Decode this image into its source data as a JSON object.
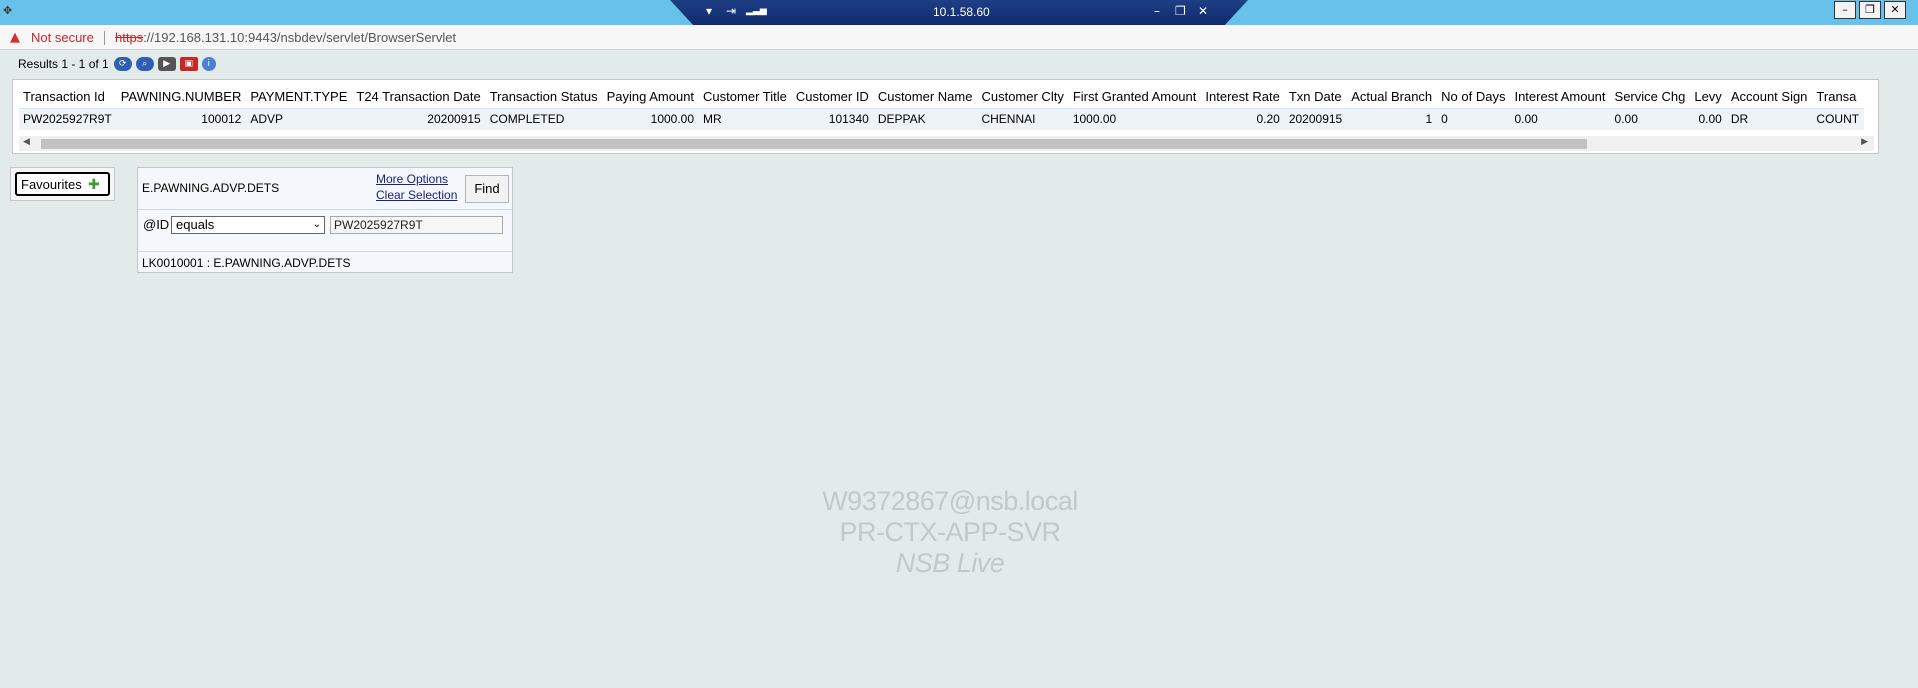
{
  "citrix": {
    "host": "10.1.58.60",
    "menu_glyph": "▾",
    "pin_glyph": "⇥",
    "signal_glyph": "▂▃▅",
    "minimize_glyph": "–",
    "restore_glyph": "❐",
    "close_glyph": "✕"
  },
  "window_controls": [
    "–",
    "❐",
    "✕"
  ],
  "address_bar": {
    "security_text": "Not secure",
    "url_scheme": "https",
    "url_rest": "://192.168.131.10:9443/nsbdev/servlet/BrowserServlet"
  },
  "toolbar": {
    "results_text": "Results 1 - 1 of 1"
  },
  "grid": {
    "columns": [
      "Transaction Id",
      "PAWNING.NUMBER",
      "PAYMENT.TYPE",
      "T24 Transaction Date",
      "Transaction Status",
      "Paying Amount",
      "Customer Title",
      "Customer ID",
      "Customer Name",
      "Customer Clty",
      "First Granted Amount",
      "Interest Rate",
      "Txn Date",
      "Actual Branch",
      "No of Days",
      "Interest Amount",
      "Service Chg",
      "Levy",
      "Account Sign",
      "Transa"
    ],
    "rows": [
      [
        "PW2025927R9T",
        "100012",
        "ADVP",
        "20200915",
        "COMPLETED",
        "1000.00",
        "MR",
        "101340",
        "DEPPAK",
        "CHENNAI",
        "1000.00",
        "0.20",
        "20200915",
        "1",
        "0",
        "0.00",
        "0.00",
        "0.00",
        "DR",
        "COUNT"
      ]
    ]
  },
  "favourites": {
    "label": "Favourites"
  },
  "selection": {
    "enquiry_name": "E.PAWNING.ADVP.DETS",
    "more_options": "More Options",
    "clear_selection": "Clear Selection",
    "find_label": "Find",
    "field_label": "@ID",
    "operator": "equals",
    "value": "PW2025927R9T",
    "footer": "LK0010001 : E.PAWNING.ADVP.DETS"
  },
  "watermark": {
    "line1": "W9372867@nsb.local",
    "line2": "PR-CTX-APP-SVR",
    "line3": "NSB Live"
  }
}
